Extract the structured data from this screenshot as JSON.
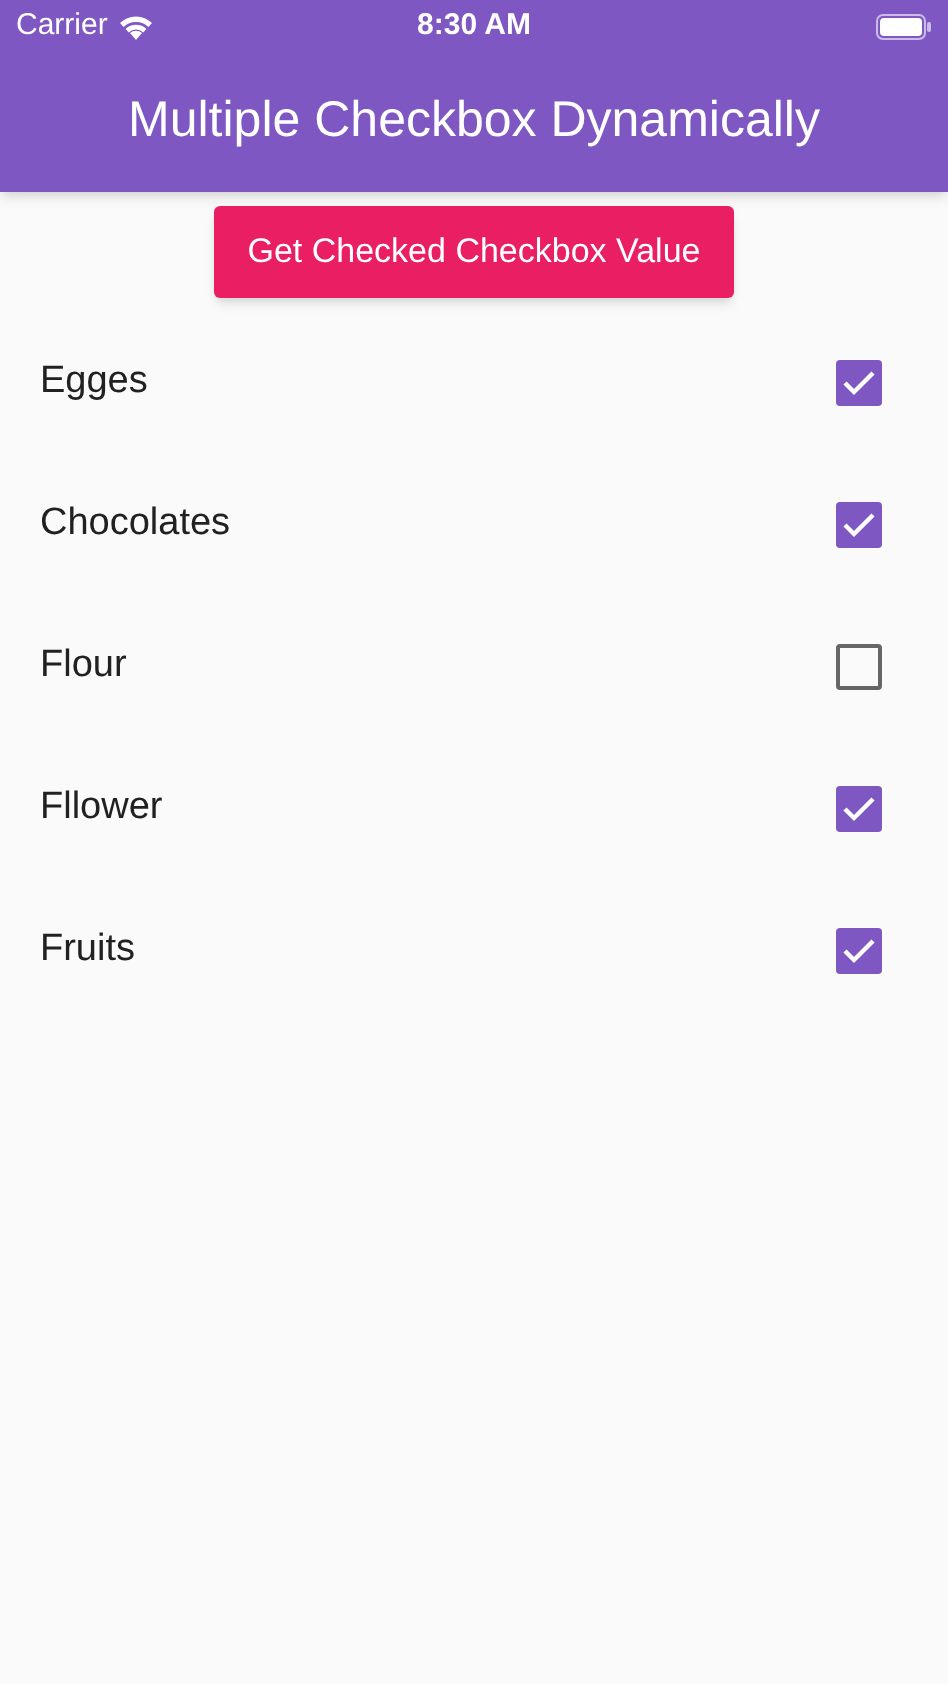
{
  "status_bar": {
    "carrier": "Carrier",
    "time": "8:30 AM"
  },
  "app_bar": {
    "title": "Multiple Checkbox Dynamically"
  },
  "button": {
    "label": "Get Checked Checkbox Value"
  },
  "items": [
    {
      "label": "Egges",
      "checked": true
    },
    {
      "label": "Chocolates",
      "checked": true
    },
    {
      "label": "Flour",
      "checked": false
    },
    {
      "label": "Fllower",
      "checked": true
    },
    {
      "label": "Fruits",
      "checked": true
    }
  ]
}
